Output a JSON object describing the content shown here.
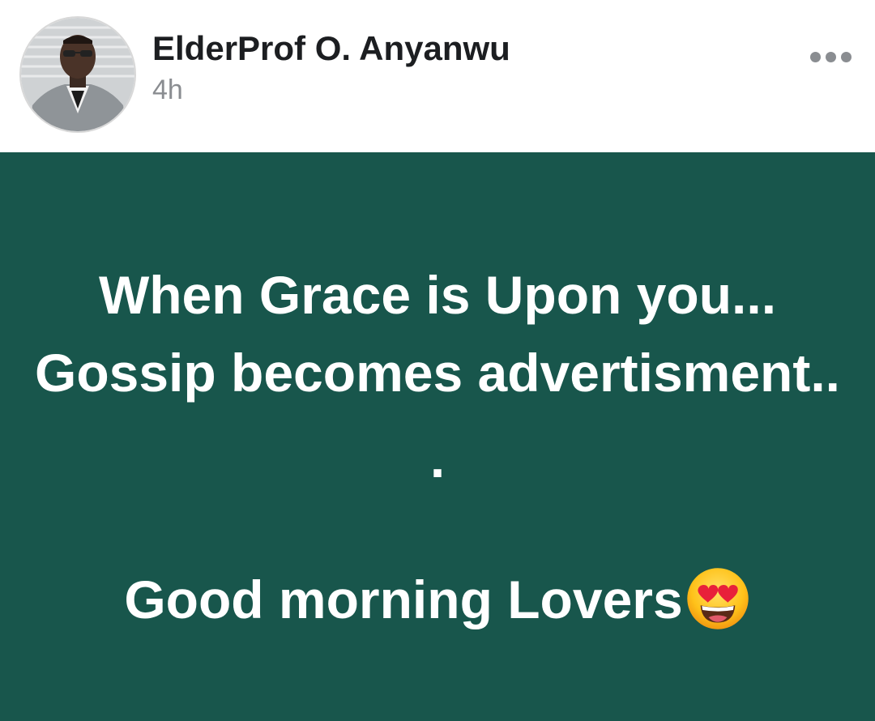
{
  "author": {
    "name": "ElderProf O. Anyanwu",
    "time": "4h",
    "avatar_icon": "profile-photo"
  },
  "header": {
    "more_icon": "more-dots-icon"
  },
  "post": {
    "background_color": "#18564c",
    "text_color": "#ffffff",
    "line1": "When Grace is Upon you...",
    "line2": "Gossip becomes advertisment..",
    "line3": ".",
    "line4": "Good morning Lovers",
    "emoji_icon": "heart-eyes-emoji"
  }
}
